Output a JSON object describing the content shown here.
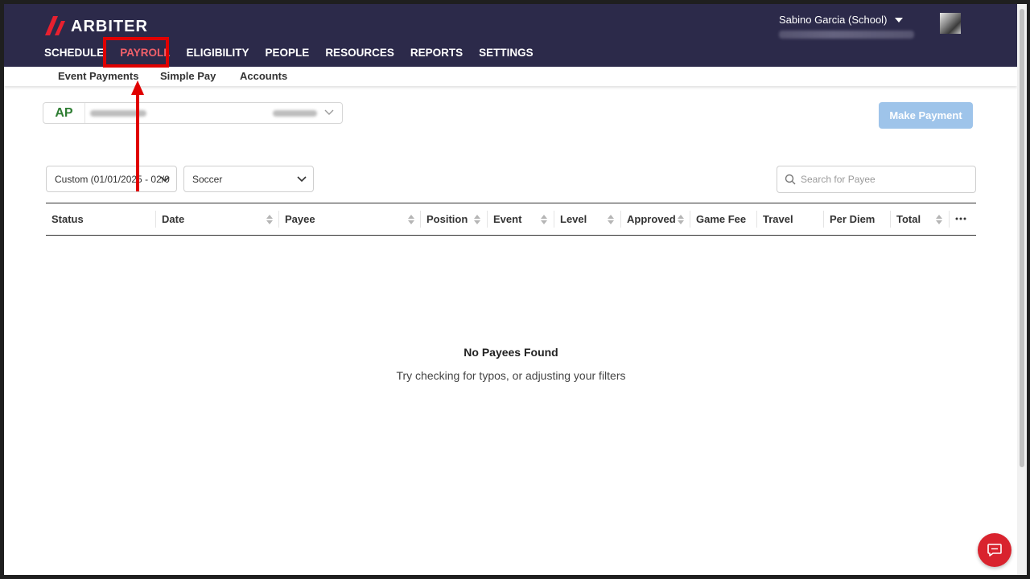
{
  "brand": {
    "name": "ARBITER",
    "accent": "#f0606a",
    "logo_red": "#e8202f",
    "topbar_bg": "#2c2a4a"
  },
  "user": {
    "name": "Sabino Garcia (School)"
  },
  "main_nav": [
    {
      "label": "SCHEDULE",
      "active": false
    },
    {
      "label": "PAYROLL",
      "active": true
    },
    {
      "label": "ELIGIBILITY",
      "active": false
    },
    {
      "label": "PEOPLE",
      "active": false
    },
    {
      "label": "RESOURCES",
      "active": false
    },
    {
      "label": "REPORTS",
      "active": false
    },
    {
      "label": "SETTINGS",
      "active": false
    }
  ],
  "sub_nav": [
    {
      "label": "Event Payments"
    },
    {
      "label": "Simple Pay"
    },
    {
      "label": "Accounts"
    }
  ],
  "account": {
    "badge": "AP"
  },
  "actions": {
    "make_payment": "Make Payment",
    "make_payment_color": "#9ec4ea"
  },
  "filters": {
    "date_range": "Custom (01/01/2025 - 02/0",
    "sport": "Soccer"
  },
  "search": {
    "placeholder": "Search for Payee",
    "value": ""
  },
  "table": {
    "columns": [
      "Status",
      "Date",
      "Payee",
      "Position",
      "Event",
      "Level",
      "Approved",
      "Game Fee",
      "Travel",
      "Per Diem",
      "Total"
    ],
    "rows": []
  },
  "empty_state": {
    "title": "No Payees Found",
    "message": "Try checking for typos, or adjusting your filters"
  },
  "annotation": {
    "highlight_color": "#e00000"
  }
}
